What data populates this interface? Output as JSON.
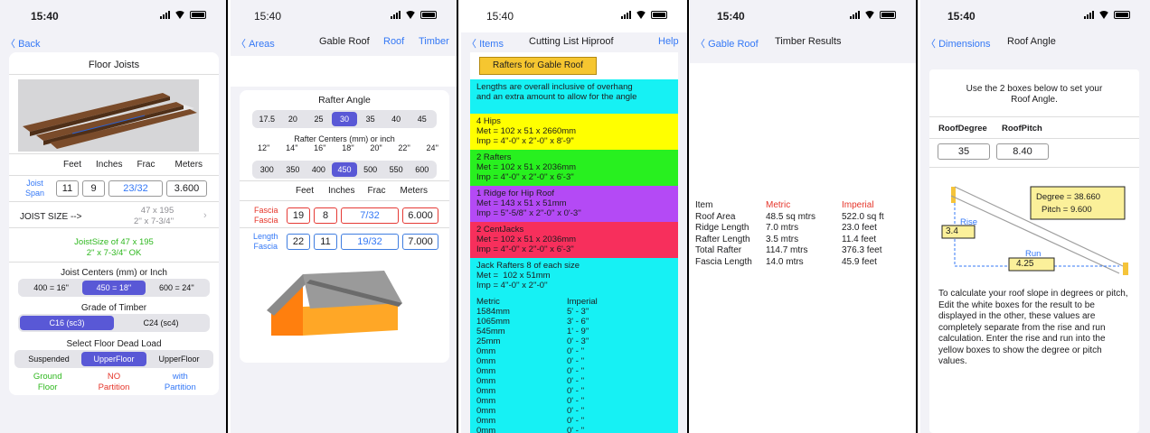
{
  "time": "15:40",
  "p1": {
    "back": "Back",
    "title": "Floor Joists",
    "col_headers": [
      "Feet",
      "Inches",
      "Frac",
      "Meters"
    ],
    "joist_span": "Joist\nSpan",
    "span_feet": "11",
    "span_inches": "9",
    "span_frac": "23/32",
    "span_meters": "3.600",
    "joist_size_label": "JOIST SIZE -->",
    "joist_size_l1": "47 x 195",
    "joist_size_l2": "2'' x 7-3/4''",
    "joist_ok_l1": "JoistSize of 47 x 195",
    "joist_ok_l2": "2'' x 7-3/4''  OK",
    "centers_title": "Joist Centers (mm) or Inch",
    "centers": [
      "400 = 16''",
      "450 = 18''",
      "600 = 24''"
    ],
    "grade_title": "Grade of Timber",
    "grades": [
      "C16 (sc3)",
      "C24 (sc4)"
    ],
    "load_title": "Select Floor Dead Load",
    "loads": [
      "Suspended",
      "UpperFloor",
      "UpperFloor"
    ],
    "notes": [
      [
        "Ground",
        "Floor"
      ],
      [
        "NO",
        "Partition"
      ],
      [
        "with",
        "Partition"
      ]
    ]
  },
  "p2": {
    "back": "Areas",
    "title": "Gable Roof",
    "roof": "Roof",
    "timber": "Timber",
    "angle_title": "Rafter Angle",
    "angles": [
      "17.5",
      "20",
      "25",
      "30",
      "35",
      "40",
      "45"
    ],
    "centers_title": "Rafter Centers (mm) or inch",
    "inch_centers": [
      "12''",
      "14''",
      "16''",
      "18''",
      "20''",
      "22''",
      "24''"
    ],
    "mm_centers": [
      "300",
      "350",
      "400",
      "450",
      "500",
      "550",
      "600"
    ],
    "col_headers": [
      "Feet",
      "Inches",
      "Frac",
      "Meters"
    ],
    "fascia_label": "Fascia\nFascia",
    "fascia": [
      "19",
      "8",
      "7/32",
      "6.000"
    ],
    "length_label": "Length\nFascia",
    "length": [
      "22",
      "11",
      "19/32",
      "7.000"
    ]
  },
  "p3": {
    "back": "Items",
    "title": "Cutting List Hiproof",
    "help": "Help",
    "button": "Rafters for Gable Roof",
    "intro": "Lengths are overall inclusive of overhang\nand an extra amount to allow for the angle",
    "items": [
      {
        "text": "4 Hips\nMet = 102 x 51 x 2660mm\nImp = 4''-0'' x 2''-0'' x 8'-9''",
        "color": "#ffff00"
      },
      {
        "text": "2 Rafters\nMet = 102 x 51 x 2036mm\nImp = 4''-0'' x 2''-0'' x 6'-3''",
        "color": "#28f01f"
      },
      {
        "text": "1 Ridge for Hip Roof\nMet = 143 x 51 x 51mm\nImp = 5''-5/8'' x 2''-0'' x 0'-3''",
        "color": "#b44af5"
      },
      {
        "text": "2 CentJacks\nMet = 102 x 51 x 2036mm\nImp = 4''-0'' x 2''-0'' x 6'-3''",
        "color": "#f72f5c"
      },
      {
        "text": "Jack Rafters 8 of each size\nMet =  102 x 51mm\nImp = 4''-0'' x 2''-0''",
        "color": "#16f1f4"
      }
    ],
    "table_head": [
      "Metric",
      "Imperial"
    ],
    "table": [
      [
        "1584mm",
        "5' - 3''"
      ],
      [
        "1065mm",
        "3' - 6''"
      ],
      [
        "545mm",
        "1' - 9''"
      ],
      [
        "25mm",
        "0' - 3''"
      ],
      [
        "0mm",
        "0' - ''"
      ],
      [
        "0mm",
        "0' - ''"
      ],
      [
        "0mm",
        "0' - ''"
      ],
      [
        "0mm",
        "0' - ''"
      ],
      [
        "0mm",
        "0' - ''"
      ],
      [
        "0mm",
        "0' - ''"
      ],
      [
        "0mm",
        "0' - ''"
      ],
      [
        "0mm",
        "0' - ''"
      ],
      [
        "0mm",
        "0' - ''"
      ]
    ]
  },
  "p4": {
    "back": "Gable Roof",
    "title": "Timber Results",
    "head": [
      "Item",
      "Metric",
      "Imperial"
    ],
    "rows": [
      [
        "Roof Area",
        "48.5 sq mtrs",
        "522.0 sq ft"
      ],
      [
        "Ridge Length",
        "7.0 mtrs",
        "23.0 feet"
      ],
      [
        "Rafter Length",
        "3.5 mtrs",
        "11.4 feet"
      ],
      [
        "Total Rafter",
        "114.7 mtrs",
        "376.3 feet"
      ],
      [
        "Fascia Length",
        "14.0 mtrs",
        "45.9 feet"
      ]
    ]
  },
  "p5": {
    "back": "Dimensions",
    "title": "Roof Angle",
    "intro": "Use the 2 boxes below to set your\nRoof Angle.",
    "deg_label": "RoofDegree",
    "pitch_label": "RoofPitch",
    "deg_value": "35",
    "pitch_value": "8.40",
    "deg_result": "Degree =  38.660",
    "pitch_result": "Pitch =  9.600",
    "rise_label": "Rise",
    "rise_value": "3.4",
    "run_label": "Run",
    "run_value": "4.25",
    "help": "To calculate your roof slope in degrees or pitch, Edit the white boxes for the result to be displayed in the other, these values are completely separate from the rise and run calculation. Enter the rise and run into the yellow boxes to show the degree or pitch values."
  }
}
